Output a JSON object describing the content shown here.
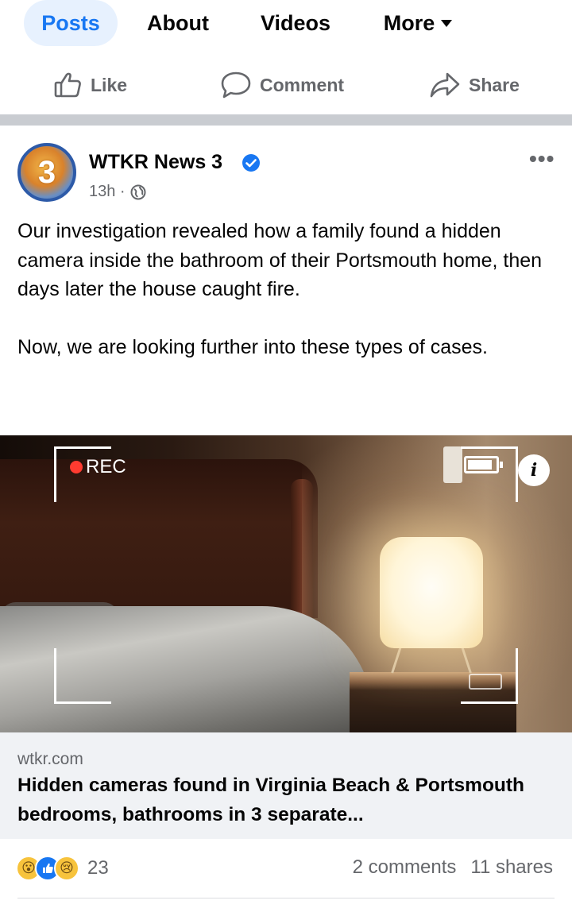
{
  "tabs": [
    {
      "label": "Posts",
      "active": true
    },
    {
      "label": "About",
      "active": false
    },
    {
      "label": "Videos",
      "active": false
    },
    {
      "label": "More",
      "active": false
    }
  ],
  "actions": {
    "like": "Like",
    "comment": "Comment",
    "share": "Share"
  },
  "post": {
    "page_name": "WTKR News 3",
    "verified": true,
    "time": "13h",
    "privacy_icon": "globe-icon",
    "avatar_text": "3",
    "paragraphs": [
      "Our investigation revealed how a family found a hidden camera inside the bathroom of their Portsmouth home, then days later the house caught fire.",
      "Now, we are looking further into these types of cases."
    ],
    "image_overlay": {
      "rec_label": "REC",
      "info_label": "i"
    },
    "link": {
      "domain": "wtkr.com",
      "title": "Hidden cameras found in Virginia Beach & Portsmouth bedrooms, bathrooms in 3 separate..."
    },
    "reactions": {
      "icons": [
        "wow-reaction-icon",
        "like-reaction-icon",
        "sad-reaction-icon"
      ],
      "count": "23"
    },
    "comments_label": "2 comments",
    "shares_label": "11 shares"
  },
  "colors": {
    "accent": "#1877f2",
    "active_tab_bg": "#e7f1fe",
    "secondary_text": "#65676b",
    "rec_dot": "#ff3b30"
  }
}
